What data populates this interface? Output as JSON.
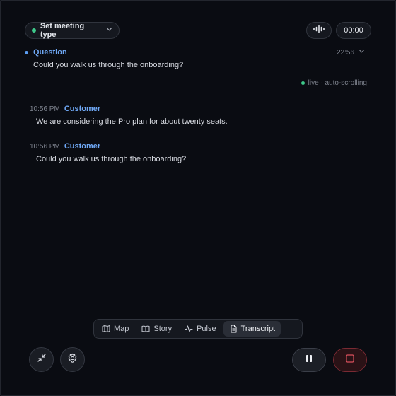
{
  "header": {
    "meeting_type_label": "Set meeting type",
    "timer": "00:00",
    "wave_icon": "waveform-icon"
  },
  "question": {
    "label": "Question",
    "time": "22:56",
    "text": "Could you walk us through the onboarding?"
  },
  "status": {
    "live_text": "live · auto-scrolling",
    "live_color": "#3ec98a"
  },
  "transcript": [
    {
      "time": "10:56 PM",
      "speaker": "Customer",
      "text": "We are considering the Pro plan for about twenty seats."
    },
    {
      "time": "10:56 PM",
      "speaker": "Customer",
      "text": "Could you walk us through the onboarding?"
    }
  ],
  "tabs": [
    {
      "label": "Map",
      "icon": "map-icon",
      "active": false
    },
    {
      "label": "Story",
      "icon": "book-icon",
      "active": false
    },
    {
      "label": "Pulse",
      "icon": "pulse-icon",
      "active": false
    },
    {
      "label": "Transcript",
      "icon": "document-icon",
      "active": true
    }
  ],
  "controls": {
    "collapse_icon": "collapse-icon",
    "settings_icon": "gear-icon",
    "pause_icon": "pause-icon",
    "stop_icon": "stop-icon"
  },
  "colors": {
    "background": "#0a0c12",
    "accent_blue": "#6fa8f5",
    "stop_red": "#d9505c"
  }
}
